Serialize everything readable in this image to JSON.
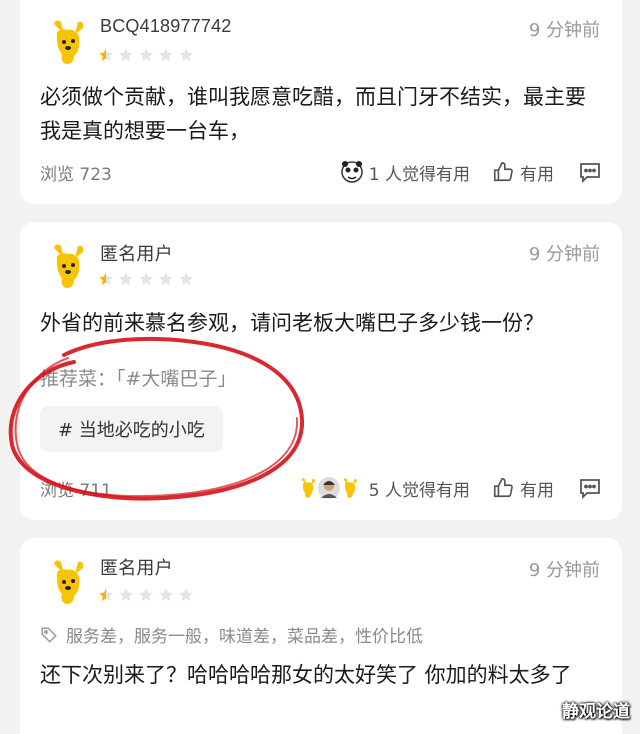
{
  "reviews": [
    {
      "username": "BCQ418977742",
      "time": "9 分钟前",
      "rating": 1,
      "content": "必须做个贡献，谁叫我愿意吃醋，而且门牙不结实，最主要我是真的想要一台车，",
      "views": "浏览 723",
      "helpful": "1 人觉得有用",
      "useful_label": "有用"
    },
    {
      "username": "匿名用户",
      "time": "9 分钟前",
      "rating": 1,
      "content": "外省的前来慕名参观，请问老板大嘴巴子多少钱一份？",
      "recommend": "推荐菜：「#大嘴巴子」",
      "tag": "# 当地必吃的小吃",
      "views": "浏览 711",
      "helpful": "5 人觉得有用",
      "useful_label": "有用"
    },
    {
      "username": "匿名用户",
      "time": "9 分钟前",
      "rating": 1,
      "criteria": "服务差，服务一般，味道差，菜品差，性价比低",
      "content": "还下次别来了？哈哈哈哈那女的太好笑了 你加的料太多了"
    }
  ],
  "watermark": "静观论道",
  "colors": {
    "star_on": "#f5b400",
    "star_off": "#e4e4e4",
    "annotation_circle": "#d4121a",
    "avatar_yellow": "#f6c400"
  },
  "icons": [
    "dog-avatar-icon",
    "star-icon",
    "thumbs-up-icon",
    "comment-icon",
    "tag-icon"
  ]
}
